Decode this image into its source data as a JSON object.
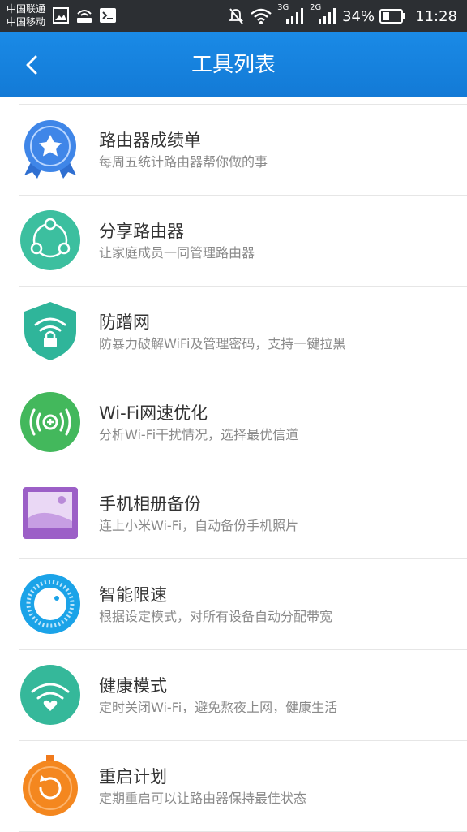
{
  "status_bar": {
    "carrier1": "中国联通",
    "carrier2": "中国移动",
    "net1": "3G",
    "net2": "2G",
    "battery": "34%",
    "time": "11:28"
  },
  "header": {
    "title": "工具列表"
  },
  "tools": [
    {
      "title": "路由器成绩单",
      "desc": "每周五统计路由器帮你做的事",
      "icon": "badge-star-icon"
    },
    {
      "title": "分享路由器",
      "desc": "让家庭成员一同管理路由器",
      "icon": "share-icon"
    },
    {
      "title": "防蹭网",
      "desc": "防暴力破解WiFi及管理密码，支持一键拉黑",
      "icon": "wifi-shield-lock-icon"
    },
    {
      "title": "Wi-Fi网速优化",
      "desc": "分析Wi-Fi干扰情况，选择最优信道",
      "icon": "signal-optimize-icon"
    },
    {
      "title": "手机相册备份",
      "desc": "连上小米Wi-Fi，自动备份手机照片",
      "icon": "photo-album-icon"
    },
    {
      "title": "智能限速",
      "desc": "根据设定模式，对所有设备自动分配带宽",
      "icon": "speed-dial-icon"
    },
    {
      "title": "健康模式",
      "desc": "定时关闭Wi-Fi，避免熬夜上网，健康生活",
      "icon": "wifi-heart-icon"
    },
    {
      "title": "重启计划",
      "desc": "定期重启可以让路由器保持最佳状态",
      "icon": "restart-timer-icon"
    }
  ]
}
